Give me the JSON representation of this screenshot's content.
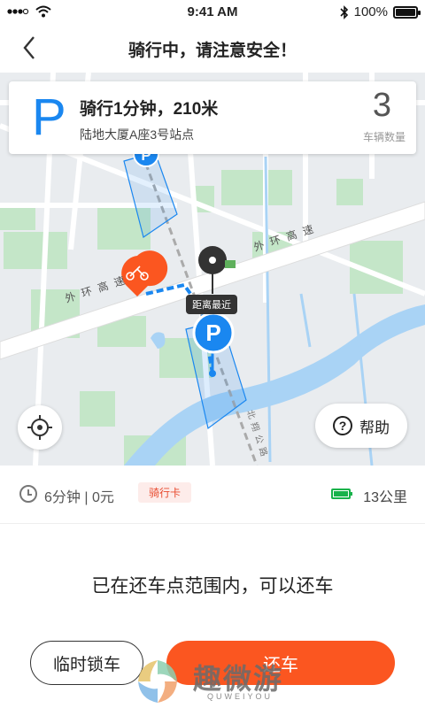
{
  "status_bar": {
    "time": "9:41 AM",
    "battery_text": "100%",
    "battery_level": 1.0
  },
  "nav": {
    "title": "骑行中，请注意安全！"
  },
  "ride_card": {
    "p_label": "P",
    "ride_summary": "骑行1分钟，210米",
    "station": "陆地大厦A座3号站点",
    "bike_count": "3",
    "bike_count_label": "车辆数量"
  },
  "map": {
    "road_label": "外 环 高 速",
    "road_label_left": "外 环 高 速",
    "tooltip": "距离最近",
    "help_label": "帮助",
    "help_icon_glyph": "?",
    "small_road": "北 翔 公 路"
  },
  "status_row": {
    "time_cost": "6分钟 | 0元",
    "card_badge": "骑行卡",
    "range": "13公里"
  },
  "message": "已在还车点范围内，可以还车",
  "buttons": {
    "lock": "临时锁车",
    "return": "还车"
  },
  "watermark": {
    "text": "趣微游",
    "sub": "QUWEIYOU"
  },
  "colors": {
    "accent": "#fb5620",
    "blue": "#1a87f0",
    "green": "#16b24a"
  }
}
